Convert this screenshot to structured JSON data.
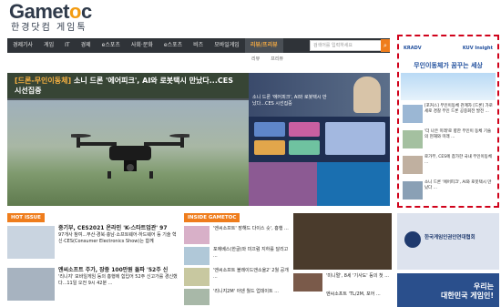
{
  "logo": {
    "main_pre": "Gamet",
    "main_o": "o",
    "main_post": "c",
    "sub": "한경닷컴 게임톡"
  },
  "nav": {
    "items": [
      "경제기사",
      "게임",
      "IT",
      "경제",
      "e스포츠",
      "사회·문화",
      "e스포츠",
      "비즈",
      "모바일게임",
      "리뷰/프리뷰"
    ],
    "active_index": 9,
    "search_placeholder": "검색어를 입력하세요"
  },
  "subnav": [
    "리뷰",
    "프리뷰"
  ],
  "hero": {
    "tag": "[드론-무인이동체]",
    "headline": "소니 드론 '에어피크', AI와 로봇택시 만났다...CES 시선집중",
    "panel1_text": "소니 드론 '에어피크', AI와 로봇택시 만났다...CES 시선집중"
  },
  "ad": {
    "brand_left": "KRADV",
    "brand_right": "KUV Insight",
    "title": "무인이동체가 꿈꾸는 세상",
    "items": [
      "[포커스] 무인이동체 관계자 [드론] 가로세로 경찰 무인 드론 공중회전 발전 ...",
      "'더 나은 미래'로 향한 무인이 동체 기술의 현재와 미래 ...",
      "로가부, CES에 참가한 국내 무인이동체 ...",
      "소니 드론 '에어피크', AI와 로봇택시 만났다 ..."
    ]
  },
  "hot_issue": {
    "label": "HOT ISSUE",
    "items": [
      {
        "title": "중기부, CES2021 온라인 'K-스타트업관' 97",
        "body": "97개사 참여...부산·경북·충남·소프트웨어·하드웨어 등 기술 혁신·CES(Consumer Electronics Show)는 함께"
      },
      {
        "title": "엔씨소프트 주가, 장중 100만원 돌파 '52주 신",
        "body": "'리니지' 모바일게임 등의 흥행에 힘입어 52주 신고가를 경신했다...11일 오전 9시 42분 ..."
      }
    ]
  },
  "inside": {
    "label": "INSIDE GAMETOC",
    "items": [
      "'엔씨소프트' 장해드 다이스 숏', 흥행 ...",
      "포에베스(한글)와 미끄럼 지하를 달리고 ...",
      "'엔씨소프트 블레이드앤소울2' 2월 공개 ...",
      "'리니지2M' 아덴 월드 업데이트 ..."
    ],
    "right_items": [
      "'미니멀', 8세 '기사도' 등의 첫 ...",
      "엔씨소프트 'TL/2M, 포어 ..."
    ]
  },
  "promo": {
    "title": "한국게임인권인연대협회",
    "bottom_line1": "우리는",
    "bottom_line2": "대한민국 게임인!"
  },
  "colors": {
    "accent": "#ef7d1c",
    "nav_bg": "#2f3338",
    "ad_border": "#d0021b",
    "brand_blue": "#1f4e9c"
  }
}
